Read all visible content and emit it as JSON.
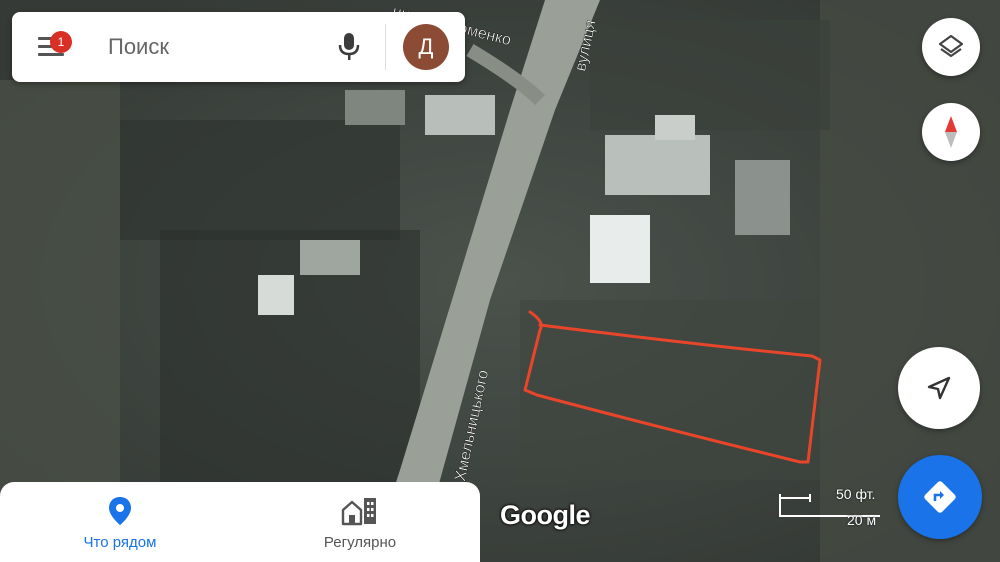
{
  "search": {
    "placeholder": "Поиск",
    "notification_count": "1",
    "avatar_initial": "Д"
  },
  "map": {
    "street_labels": [
      "нии Пархоменко",
      "вулиця",
      "я Хмельницького"
    ],
    "attribution": "Google",
    "scale": {
      "imperial": "50 фт.",
      "metric": "20 м"
    }
  },
  "bottom_nav": [
    {
      "label": "Что рядом",
      "active": true
    },
    {
      "label": "Регулярно",
      "active": false
    }
  ],
  "colors": {
    "accent": "#1a73e8",
    "badge": "#d93025",
    "avatar": "#8b4b35",
    "annotation": "#e8452a",
    "compass_red": "#e53935"
  },
  "icons": [
    "menu-icon",
    "mic-icon",
    "layers-icon",
    "compass-icon",
    "my-location-icon",
    "directions-icon",
    "place-pin-icon",
    "commute-icon"
  ]
}
